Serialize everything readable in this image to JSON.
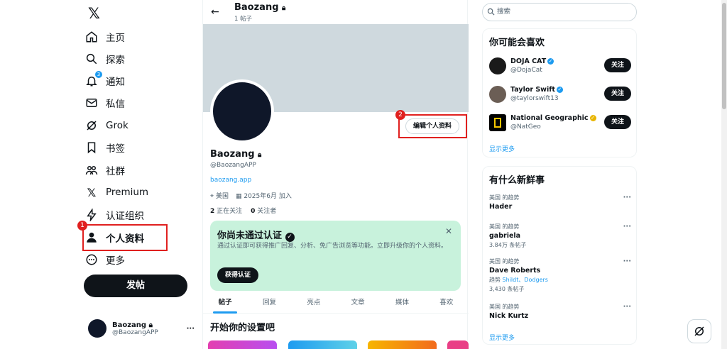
{
  "sidebar": {
    "items": [
      {
        "label": "主页",
        "icon": "home-icon"
      },
      {
        "label": "探索",
        "icon": "search-icon"
      },
      {
        "label": "通知",
        "icon": "bell-icon",
        "badge": "3"
      },
      {
        "label": "私信",
        "icon": "mail-icon"
      },
      {
        "label": "Grok",
        "icon": "grok-icon"
      },
      {
        "label": "书签",
        "icon": "bookmark-icon"
      },
      {
        "label": "社群",
        "icon": "communities-icon"
      },
      {
        "label": "Premium",
        "icon": "x-icon"
      },
      {
        "label": "认证组织",
        "icon": "lightning-icon"
      },
      {
        "label": "个人资料",
        "icon": "person-icon"
      },
      {
        "label": "更多",
        "icon": "more-icon"
      }
    ],
    "post_label": "发帖",
    "account": {
      "name": "Baozang",
      "handle": "@BaozangAPP"
    }
  },
  "annotations": {
    "first": "1",
    "second": "2"
  },
  "profile": {
    "top_name": "Baozang",
    "post_count": "1 帖子",
    "edit_label": "编辑个人资料",
    "name": "Baozang",
    "handle": "@BaozangAPP",
    "link": "baozang.app",
    "location": "美国",
    "joined": "2025年6月 加入",
    "following_count": "2",
    "following_label": "正在关注",
    "followers_count": "0",
    "followers_label": "关注者"
  },
  "verify_card": {
    "title": "你尚未通过认证",
    "text": "通过认证即可获得推广回复、分析、免广告浏览等功能。立即升级你的个人资料。",
    "button": "获得认证"
  },
  "tabs": [
    "帖子",
    "回复",
    "亮点",
    "文章",
    "媒体",
    "喜欢"
  ],
  "setup_title": "开始你的设置吧",
  "search_placeholder": "搜索",
  "who_to_follow": {
    "title": "你可能会喜欢",
    "users": [
      {
        "name": "DOJA CAT",
        "handle": "@DojaCat",
        "button": "关注"
      },
      {
        "name": "Taylor Swift",
        "handle": "@taylorswift13",
        "button": "关注"
      },
      {
        "name": "National Geographic",
        "handle": "@NatGeo",
        "button": "关注"
      }
    ],
    "more": "显示更多"
  },
  "trends": {
    "title": "有什么新鲜事",
    "items": [
      {
        "context": "美国 的趋势",
        "title": "Hader"
      },
      {
        "context": "美国 的趋势",
        "title": "gabriela",
        "count": "3.84万 条帖子"
      },
      {
        "context": "美国 的趋势",
        "title": "Dave Roberts",
        "related_prefix": "趋势",
        "related": "Shildt、Dodgers",
        "count": "3,430 条帖子"
      },
      {
        "context": "美国 的趋势",
        "title": "Nick Kurtz"
      }
    ],
    "more": "显示更多"
  },
  "colors": {
    "accent": "#1d9bf0",
    "annotation": "#e0201f",
    "verify_bg": "#c8f2dc"
  }
}
